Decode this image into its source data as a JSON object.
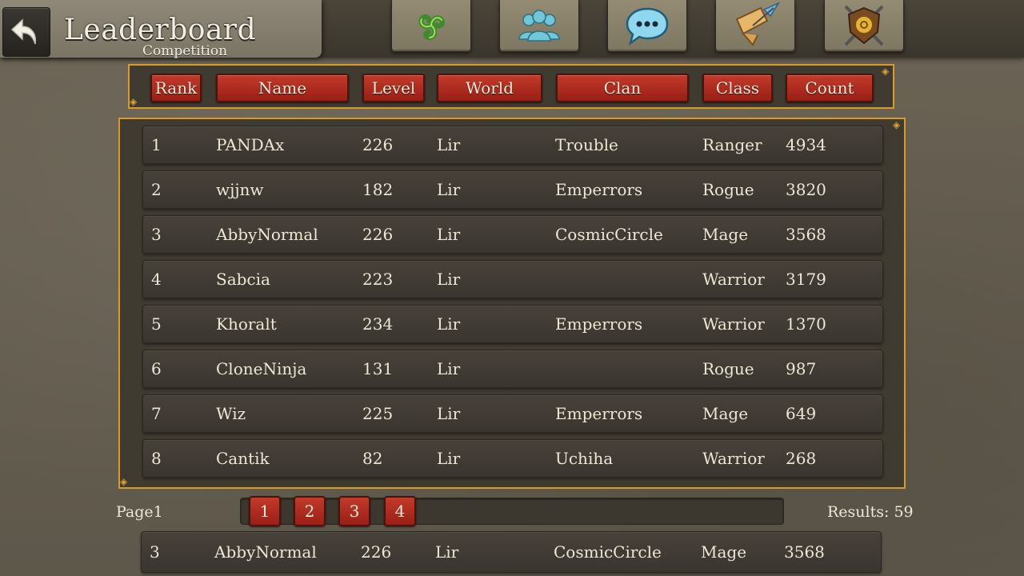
{
  "header": {
    "title": "Leaderboard",
    "subtitle": "Competition",
    "nav": [
      {
        "icon": "triskelion-icon"
      },
      {
        "icon": "friends-icon"
      },
      {
        "icon": "chat-icon"
      },
      {
        "icon": "quest-scroll-icon"
      },
      {
        "icon": "guild-crest-icon"
      }
    ]
  },
  "columns": {
    "rank": "Rank",
    "name": "Name",
    "level": "Level",
    "world": "World",
    "clan": "Clan",
    "class": "Class",
    "count": "Count"
  },
  "rows": [
    {
      "rank": "1",
      "name": "PANDAx",
      "level": "226",
      "world": "Lir",
      "clan": "Trouble",
      "class": "Ranger",
      "count": "4934"
    },
    {
      "rank": "2",
      "name": "wjjnw",
      "level": "182",
      "world": "Lir",
      "clan": "Emperrors",
      "class": "Rogue",
      "count": "3820"
    },
    {
      "rank": "3",
      "name": "AbbyNormal",
      "level": "226",
      "world": "Lir",
      "clan": "CosmicCircle",
      "class": "Mage",
      "count": "3568"
    },
    {
      "rank": "4",
      "name": "Sabcia",
      "level": "223",
      "world": "Lir",
      "clan": "",
      "class": "Warrior",
      "count": "3179"
    },
    {
      "rank": "5",
      "name": "Khoralt",
      "level": "234",
      "world": "Lir",
      "clan": "Emperrors",
      "class": "Warrior",
      "count": "1370"
    },
    {
      "rank": "6",
      "name": "CloneNinja",
      "level": "131",
      "world": "Lir",
      "clan": "",
      "class": "Rogue",
      "count": "987"
    },
    {
      "rank": "7",
      "name": "Wiz",
      "level": "225",
      "world": "Lir",
      "clan": "Emperrors",
      "class": "Mage",
      "count": "649"
    },
    {
      "rank": "8",
      "name": "Cantik",
      "level": "82",
      "world": "Lir",
      "clan": "Uchiha",
      "class": "Warrior",
      "count": "268"
    }
  ],
  "pagination": {
    "label": "Page1",
    "pages": [
      "1",
      "2",
      "3",
      "4"
    ],
    "results": "Results: 59"
  },
  "my_row": {
    "rank": "3",
    "name": "AbbyNormal",
    "level": "226",
    "world": "Lir",
    "clan": "CosmicCircle",
    "class": "Mage",
    "count": "3568"
  }
}
